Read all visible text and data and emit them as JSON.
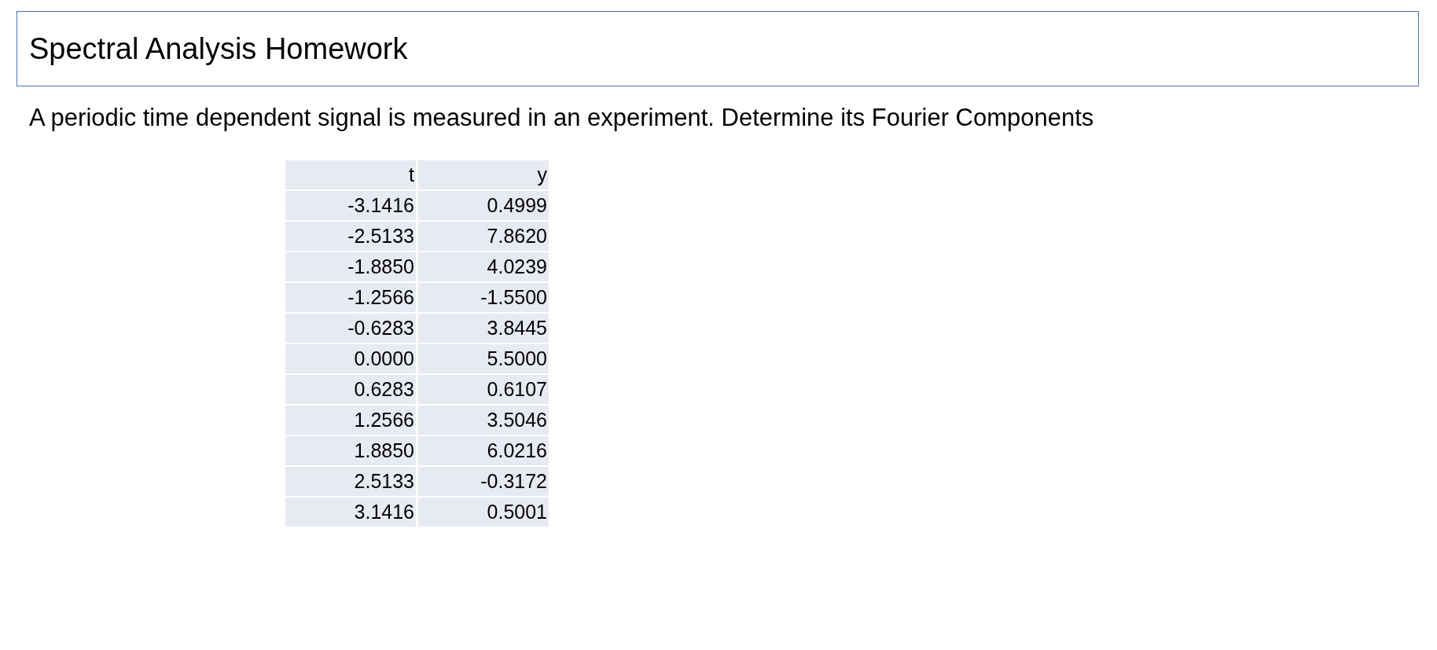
{
  "title": "Spectral Analysis Homework",
  "description": "A periodic time dependent signal is measured in an experiment. Determine its Fourier Components",
  "table": {
    "columns": [
      "t",
      "y"
    ],
    "rows": [
      [
        "-3.1416",
        "0.4999"
      ],
      [
        "-2.5133",
        "7.8620"
      ],
      [
        "-1.8850",
        "4.0239"
      ],
      [
        "-1.2566",
        "-1.5500"
      ],
      [
        "-0.6283",
        "3.8445"
      ],
      [
        "0.0000",
        "5.5000"
      ],
      [
        "0.6283",
        "0.6107"
      ],
      [
        "1.2566",
        "3.5046"
      ],
      [
        "1.8850",
        "6.0216"
      ],
      [
        "2.5133",
        "-0.3172"
      ],
      [
        "3.1416",
        "0.5001"
      ]
    ]
  }
}
